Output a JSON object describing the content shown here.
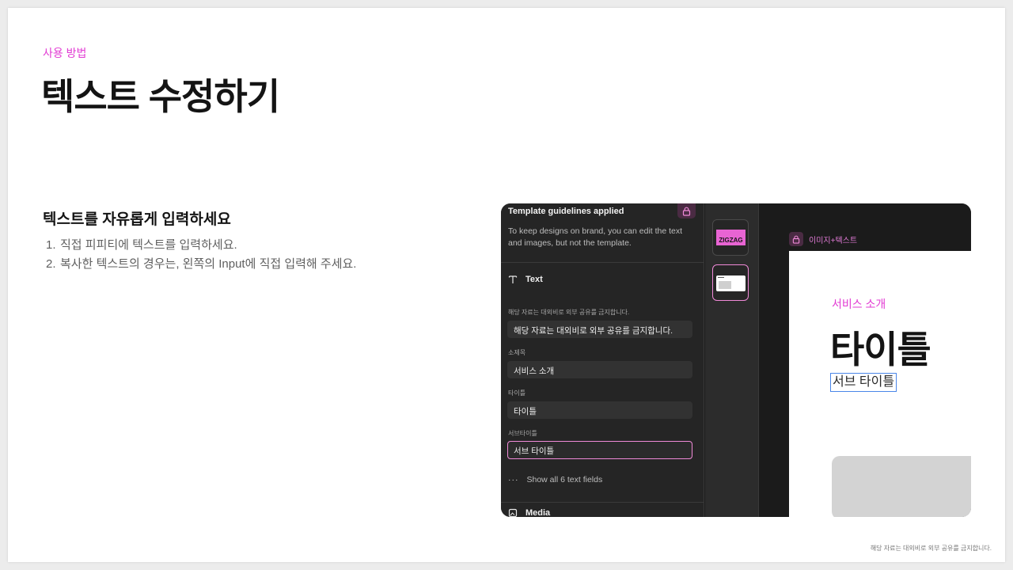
{
  "slide": {
    "eyebrow": "사용 방법",
    "headline": "텍스트 수정하기",
    "sub_heading": "텍스트를 자유롭게 입력하세요",
    "steps": [
      {
        "num": "1.",
        "text": "직접 피피티에 텍스트를 입력하세요."
      },
      {
        "num": "2.",
        "text": "복사한 텍스트의 경우는, 왼쪽의 Input에 직접 입력해 주세요."
      }
    ],
    "footer_note": "해당 자료는 대외비로 외부 공유를 금지합니다."
  },
  "panel": {
    "banner_title": "Template guidelines applied",
    "banner_desc": "To keep designs on brand, you can edit the text and images, but not the template.",
    "text_section_label": "Text",
    "fields": [
      {
        "label": "해당 자료는 대외비로 외부 공유를 금지합니다.",
        "value": "해당 자료는 대외비로 외부 공유를 금지합니다."
      },
      {
        "label": "소제목",
        "value": "서비스 소개"
      },
      {
        "label": "타이틀",
        "value": "타이틀"
      },
      {
        "label": "서브타이틀",
        "value": "서브 타이틀"
      }
    ],
    "show_all": "Show all 6 text fields",
    "media_section_label": "Media"
  },
  "thumbnails": {
    "first_label": "ZIGZAG"
  },
  "canvas": {
    "tag": "이미지+텍스트",
    "artboard": {
      "eyebrow": "서비스 소개",
      "title": "타이틀",
      "subtitle": "서브 타이틀"
    }
  },
  "colors": {
    "accent_pink": "#e23bd3",
    "field_active_border": "#f08ad8",
    "selection_blue": "#4a86e8"
  }
}
